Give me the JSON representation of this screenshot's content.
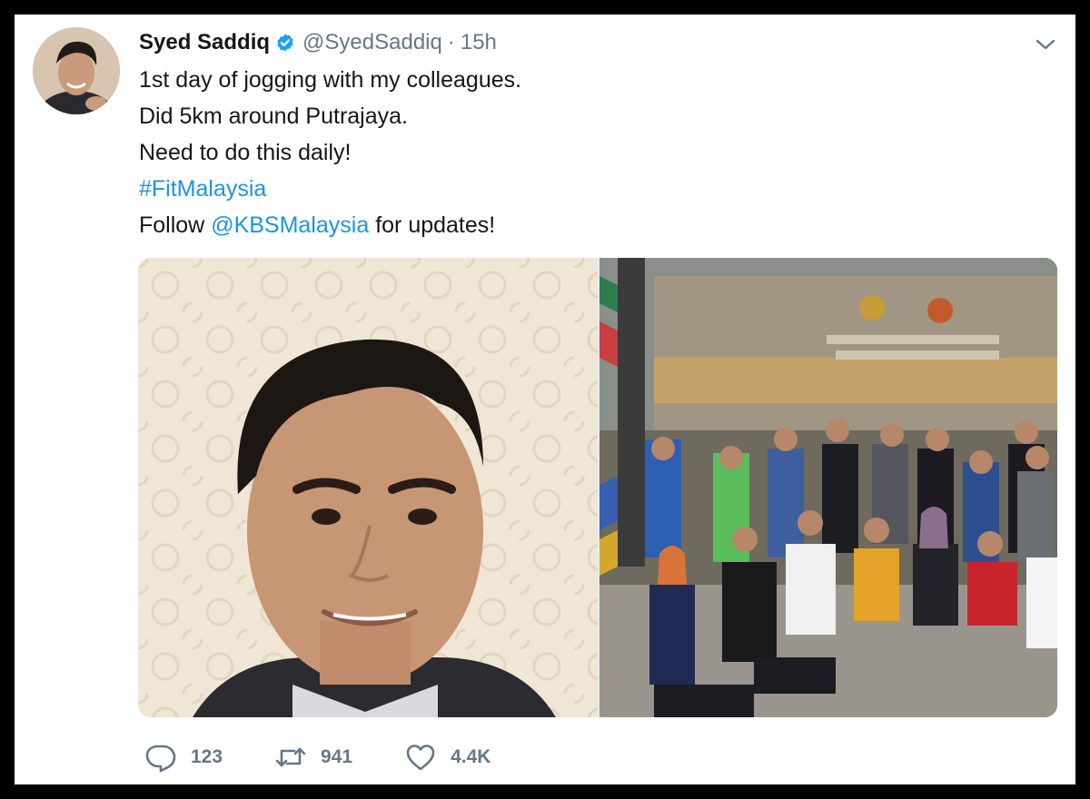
{
  "author": {
    "name": "Syed Saddiq",
    "handle": "@SyedSaddiq",
    "separator": "·",
    "time": "15h",
    "verified": true
  },
  "text": {
    "line1": "1st day of jogging with my colleagues.",
    "line2": "Did 5km around Putrajaya.",
    "line3": "Need to do this daily!",
    "hashtag": "#FitMalaysia",
    "line5_prefix": "Follow ",
    "mention": "@KBSMalaysia",
    "line5_suffix": " for updates!"
  },
  "media": {
    "photo_left": "selfie-photo",
    "photo_right": "group-photo"
  },
  "actions": {
    "replies": "123",
    "retweets": "941",
    "likes": "4.4K"
  },
  "colors": {
    "link": "#1b95e0",
    "text": "#14171a",
    "muted": "#657786",
    "verified": "#1da1f2"
  },
  "icons": [
    "verified-badge-icon",
    "chevron-down-icon",
    "reply-icon",
    "retweet-icon",
    "like-icon"
  ]
}
